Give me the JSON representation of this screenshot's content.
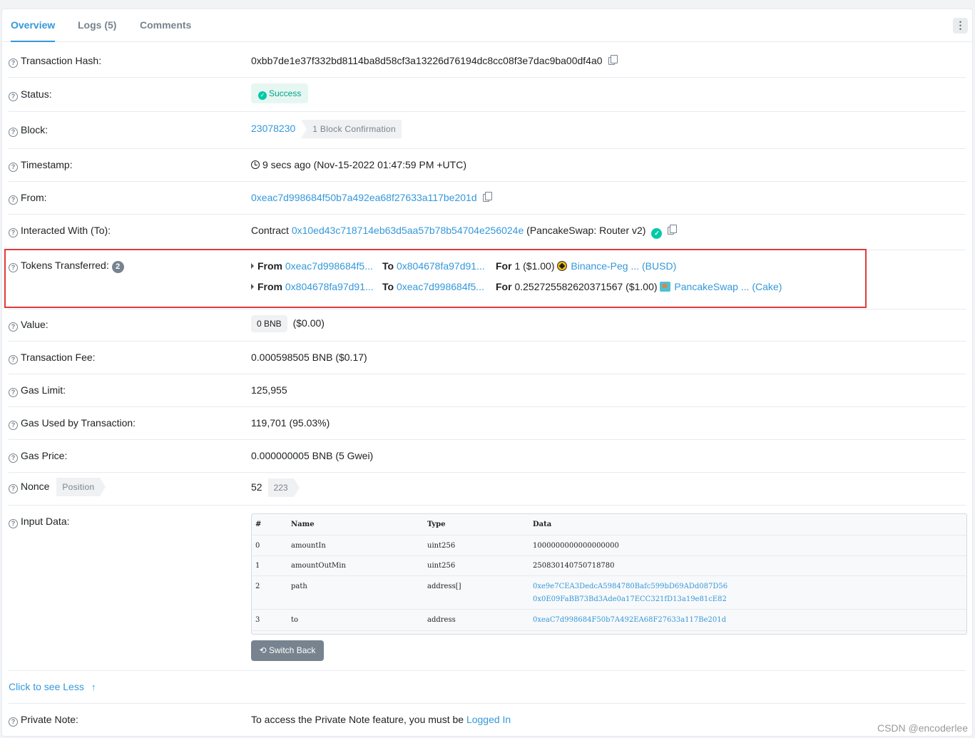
{
  "tabs": [
    {
      "label": "Overview"
    },
    {
      "label": "Logs (5)"
    },
    {
      "label": "Comments"
    }
  ],
  "more_button": "⋮",
  "rows": {
    "tx_hash": {
      "label": "Transaction Hash:",
      "value": "0xbb7de1e37f332bd8114ba8d58cf3a13226d76194dc8cc08f3e7dac9ba00df4a0"
    },
    "status": {
      "label": "Status:",
      "value": "Success"
    },
    "block": {
      "label": "Block:",
      "value": "23078230",
      "confirmation": "1 Block Confirmation"
    },
    "timestamp": {
      "label": "Timestamp:",
      "value": "9 secs ago (Nov-15-2022 01:47:59 PM +UTC)"
    },
    "from": {
      "label": "From:",
      "value": "0xeac7d998684f50b7a492ea68f27633a117be201d"
    },
    "interacted": {
      "label": "Interacted With (To):",
      "prefix": "Contract",
      "address": "0x10ed43c718714eb63d5aa57b78b54704e256024e",
      "name": "(PancakeSwap: Router v2)"
    },
    "tokens": {
      "label": "Tokens Transferred:",
      "count": "2",
      "transfers": [
        {
          "from_label": "From",
          "from": "0xeac7d998684f5...",
          "to_label": "To",
          "to": "0x804678fa97d91...",
          "for_label": "For",
          "amount": "1 ($1.00)",
          "token": "Binance-Peg ... (BUSD)"
        },
        {
          "from_label": "From",
          "from": "0x804678fa97d91...",
          "to_label": "To",
          "to": "0xeac7d998684f5...",
          "for_label": "For",
          "amount": "0.252725582620371567 ($1.00)",
          "token": "PancakeSwap ... (Cake)"
        }
      ]
    },
    "value": {
      "label": "Value:",
      "chip": "0 BNB",
      "usd": "($0.00)"
    },
    "fee": {
      "label": "Transaction Fee:",
      "value": "0.000598505 BNB ($0.17)"
    },
    "gas_limit": {
      "label": "Gas Limit:",
      "value": "125,955"
    },
    "gas_used": {
      "label": "Gas Used by Transaction:",
      "value": "119,701 (95.03%)"
    },
    "gas_price": {
      "label": "Gas Price:",
      "value": "0.000000005 BNB (5 Gwei)"
    },
    "nonce": {
      "label": "Nonce",
      "position_tag": "Position",
      "value": "52",
      "position": "223"
    },
    "input": {
      "label": "Input Data:",
      "headers": [
        "#",
        "Name",
        "Type",
        "Data"
      ],
      "rows": [
        {
          "idx": "0",
          "name": "amountIn",
          "type": "uint256",
          "data": [
            "1000000000000000000"
          ]
        },
        {
          "idx": "1",
          "name": "amountOutMin",
          "type": "uint256",
          "data": [
            "250830140750718780"
          ]
        },
        {
          "idx": "2",
          "name": "path",
          "type": "address[]",
          "data": [
            "0xe9e7CEA3DedcA5984780Bafc599bD69ADd087D56",
            "0x0E09FaBB73Bd3Ade0a17ECC321fD13a19e81cE82"
          ]
        },
        {
          "idx": "3",
          "name": "to",
          "type": "address",
          "data": [
            "0xeaC7d998684F50b7A492EA68F27633a117Be201d"
          ]
        }
      ],
      "switch_label": "Switch Back"
    },
    "see_less": "Click to see Less",
    "private_note": {
      "label": "Private Note:",
      "text": "To access the Private Note feature, you must be",
      "link": "Logged In"
    }
  },
  "watermark": "CSDN @encoderlee"
}
